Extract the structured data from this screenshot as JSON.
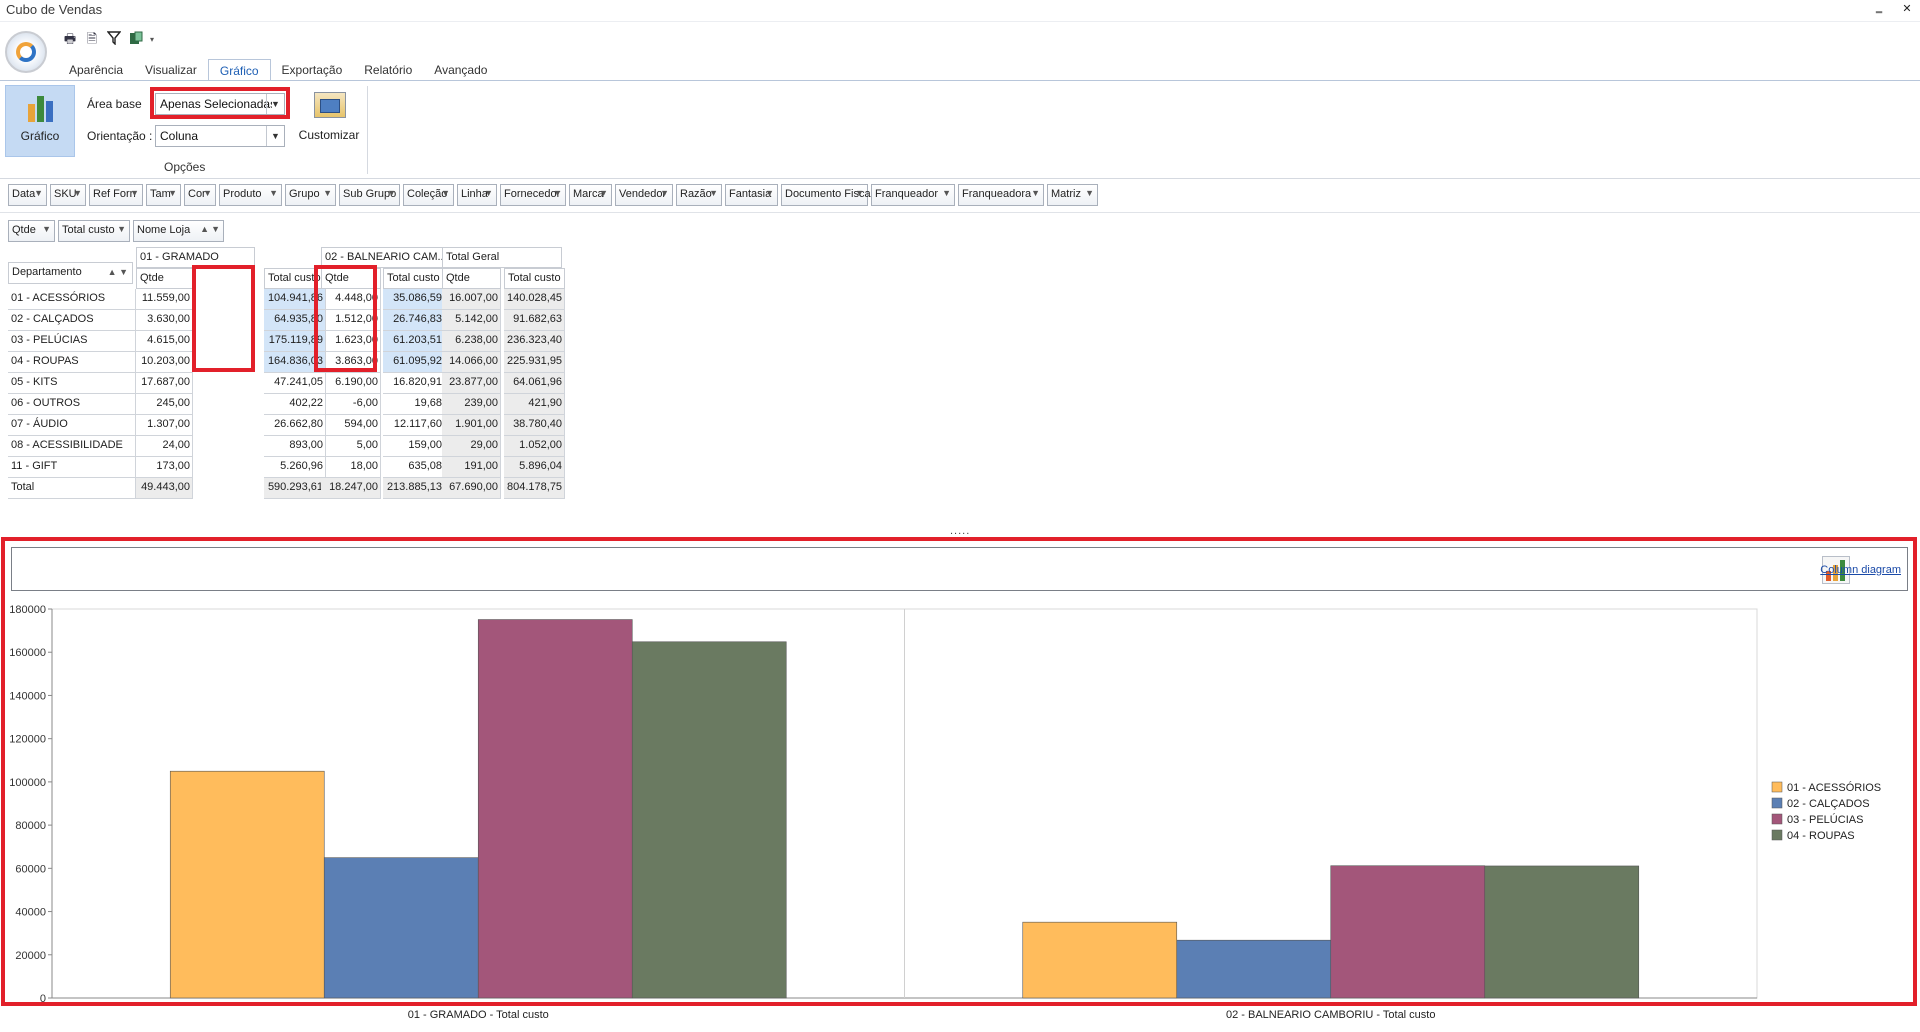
{
  "window": {
    "title": "Cubo de Vendas",
    "minimize_label": "‗",
    "close_label": "✕"
  },
  "quick_access": {
    "icons": [
      "print-icon",
      "preview-icon",
      "filter-icon",
      "export-icon"
    ],
    "dropdown_label": "▾"
  },
  "ribbon": {
    "tabs": [
      "Aparência",
      "Visualizar",
      "Gráfico",
      "Exportação",
      "Relatório",
      "Avançado"
    ],
    "active_tab": "Gráfico",
    "chart_button_label": "Gráfico",
    "area_base_label": "Área base",
    "area_base_value": "Apenas Selecionadas",
    "orientation_label": "Orientação :",
    "orientation_value": "Coluna",
    "customize_label": "Customizar",
    "group_label": "Opções"
  },
  "field_headers": [
    "Data",
    "SKU",
    "Ref Forn",
    "Tam",
    "Cor",
    "Produto",
    "Grupo",
    "Sub Grupo",
    "Coleção",
    "Linha",
    "Fornecedor",
    "Marca",
    "Vendedor",
    "Razão",
    "Fantasia",
    "Documento Fiscal",
    "Franqueador",
    "Franqueadora",
    "Matriz"
  ],
  "data_fields": [
    "Qtde",
    "Total custo"
  ],
  "column_field": "Nome Loja",
  "row_field": "Departamento",
  "pivot": {
    "stores": [
      "01 - GRAMADO",
      "02 - BALNEARIO CAM...",
      "Total Geral"
    ],
    "measures": [
      "Qtde",
      "Total custo",
      "Qtde",
      "Total custo",
      "Qtde",
      "Total custo"
    ],
    "rows": [
      {
        "label": "01 - ACESSÓRIOS",
        "values": [
          "11.559,00",
          "104.941,86",
          "4.448,00",
          "35.086,59",
          "16.007,00",
          "140.028,45"
        ]
      },
      {
        "label": "02 - CALÇADOS",
        "values": [
          "3.630,00",
          "64.935,80",
          "1.512,00",
          "26.746,83",
          "5.142,00",
          "91.682,63"
        ]
      },
      {
        "label": "03 - PELÚCIAS",
        "values": [
          "4.615,00",
          "175.119,89",
          "1.623,00",
          "61.203,51",
          "6.238,00",
          "236.323,40"
        ]
      },
      {
        "label": "04 - ROUPAS",
        "values": [
          "10.203,00",
          "164.836,03",
          "3.863,00",
          "61.095,92",
          "14.066,00",
          "225.931,95"
        ]
      },
      {
        "label": "05 - KITS",
        "values": [
          "17.687,00",
          "47.241,05",
          "6.190,00",
          "16.820,91",
          "23.877,00",
          "64.061,96"
        ]
      },
      {
        "label": "06 - OUTROS",
        "values": [
          "245,00",
          "402,22",
          "-6,00",
          "19,68",
          "239,00",
          "421,90"
        ]
      },
      {
        "label": "07 - ÁUDIO",
        "values": [
          "1.307,00",
          "26.662,80",
          "594,00",
          "12.117,60",
          "1.901,00",
          "38.780,40"
        ]
      },
      {
        "label": "08 - ACESSIBILIDADE",
        "values": [
          "24,00",
          "893,00",
          "5,00",
          "159,00",
          "29,00",
          "1.052,00"
        ]
      },
      {
        "label": "11 - GIFT",
        "values": [
          "173,00",
          "5.260,96",
          "18,00",
          "635,08",
          "191,00",
          "5.896,04"
        ]
      }
    ],
    "total": {
      "label": "Total",
      "values": [
        "49.443,00",
        "590.293,61",
        "18.247,00",
        "213.885,13",
        "67.690,00",
        "804.178,75"
      ]
    }
  },
  "splitter_label": ".....",
  "chart_header": {
    "link_label": "Column diagram"
  },
  "chart_data": {
    "type": "bar",
    "categories": [
      "01 - GRAMADO         - Total custo",
      "02 - BALNEARIO CAMBORIU   - Total custo"
    ],
    "series": [
      {
        "name": "01 - ACESSÓRIOS",
        "values": [
          104941.86,
          35086.59
        ],
        "color": "#ffbc5c"
      },
      {
        "name": "02 - CALÇADOS",
        "values": [
          64935.8,
          26746.83
        ],
        "color": "#5b7fb4"
      },
      {
        "name": "03 - PELÚCIAS",
        "values": [
          175119.89,
          61203.51
        ],
        "color": "#a3567a"
      },
      {
        "name": "04 - ROUPAS",
        "values": [
          164836.03,
          61095.92
        ],
        "color": "#6a7a61"
      }
    ],
    "yticks": [
      "0",
      "20000",
      "40000",
      "60000",
      "80000",
      "100000",
      "120000",
      "140000",
      "160000",
      "180000"
    ],
    "ylim": [
      0,
      180000
    ],
    "grid": false,
    "legend": "right"
  }
}
